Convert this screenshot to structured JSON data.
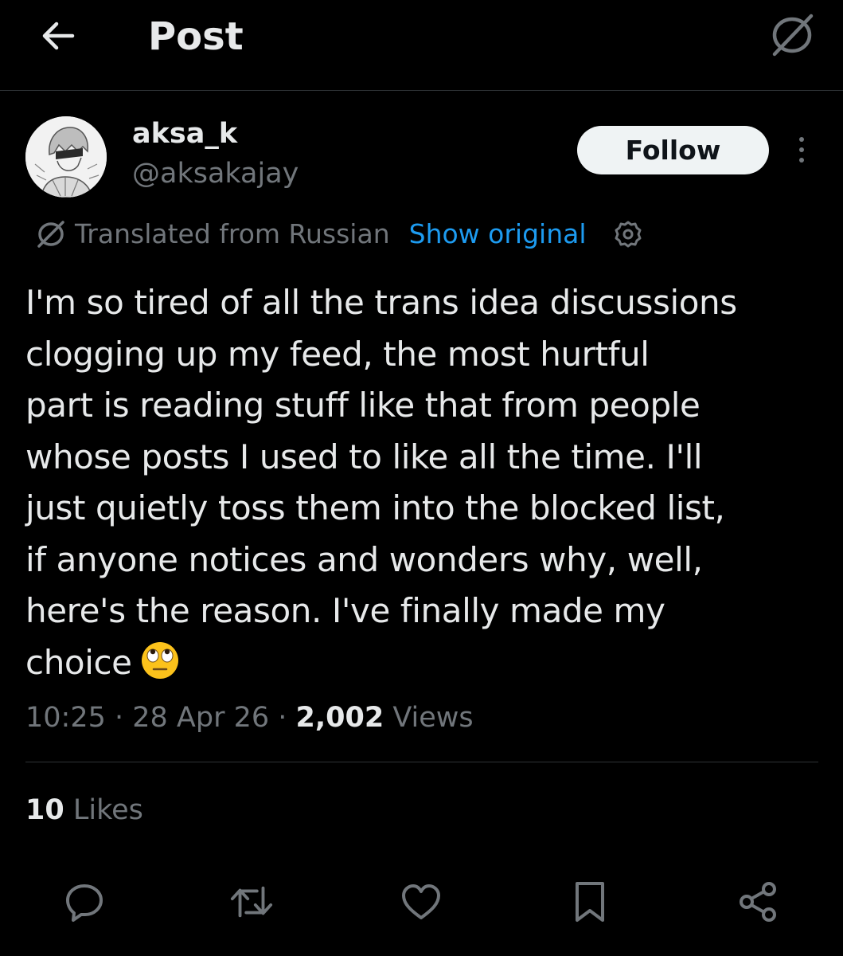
{
  "header": {
    "title": "Post",
    "back_icon": "arrow-left-icon",
    "translate_icon": "translate-icon"
  },
  "author": {
    "display_name": "aksa_k",
    "handle": "@aksakajay",
    "follow_label": "Follow",
    "more_icon": "more-vertical-icon"
  },
  "translation": {
    "label": "Translated from Russian",
    "show_original": "Show original",
    "settings_icon": "gear-icon"
  },
  "post": {
    "text": "I'm so tired of all the trans idea discussions\nclogging up my feed, the most hurtful\npart is reading stuff like that from people\nwhose posts I used to like all the time. I'll\njust quietly toss them into the blocked list,\nif anyone notices and wonders why, well,\nhere's the reason. I've finally made my\nchoice",
    "emoji": "eye-roll-emoji"
  },
  "meta": {
    "time": "10:25",
    "separator": " · ",
    "date": "28 Apr 26",
    "views_count": "2,002",
    "views_label": " Views"
  },
  "stats": {
    "likes_count": "10",
    "likes_label": " Likes"
  },
  "actions": [
    {
      "name": "reply",
      "icon": "reply-icon"
    },
    {
      "name": "repost",
      "icon": "repost-icon"
    },
    {
      "name": "like",
      "icon": "heart-icon"
    },
    {
      "name": "bookmark",
      "icon": "bookmark-icon"
    },
    {
      "name": "share",
      "icon": "share-icon"
    }
  ],
  "colors": {
    "background": "#000000",
    "text_primary": "#e7e9ea",
    "text_secondary": "#71767b",
    "link": "#1d9bf0",
    "border": "#2f3336",
    "follow_bg": "#eff3f4"
  }
}
